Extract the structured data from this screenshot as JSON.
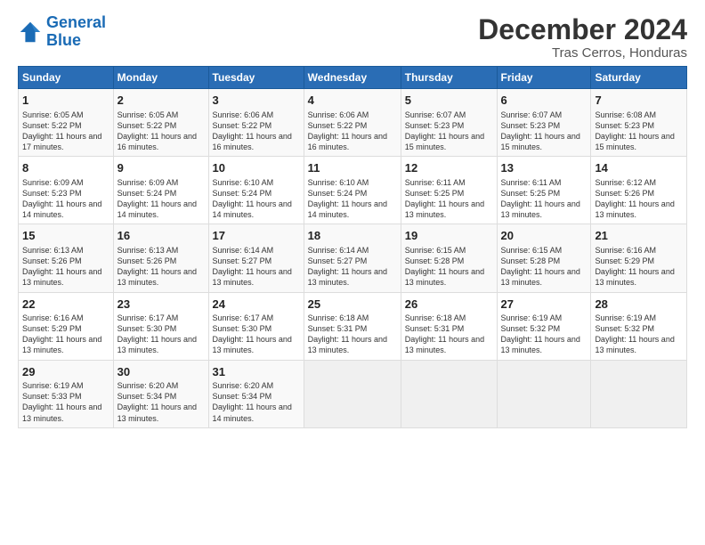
{
  "header": {
    "logo_line1": "General",
    "logo_line2": "Blue",
    "title": "December 2024",
    "subtitle": "Tras Cerros, Honduras"
  },
  "calendar": {
    "days_of_week": [
      "Sunday",
      "Monday",
      "Tuesday",
      "Wednesday",
      "Thursday",
      "Friday",
      "Saturday"
    ],
    "weeks": [
      [
        {
          "day": "1",
          "info": "Sunrise: 6:05 AM\nSunset: 5:22 PM\nDaylight: 11 hours and 17 minutes."
        },
        {
          "day": "2",
          "info": "Sunrise: 6:05 AM\nSunset: 5:22 PM\nDaylight: 11 hours and 16 minutes."
        },
        {
          "day": "3",
          "info": "Sunrise: 6:06 AM\nSunset: 5:22 PM\nDaylight: 11 hours and 16 minutes."
        },
        {
          "day": "4",
          "info": "Sunrise: 6:06 AM\nSunset: 5:22 PM\nDaylight: 11 hours and 16 minutes."
        },
        {
          "day": "5",
          "info": "Sunrise: 6:07 AM\nSunset: 5:23 PM\nDaylight: 11 hours and 15 minutes."
        },
        {
          "day": "6",
          "info": "Sunrise: 6:07 AM\nSunset: 5:23 PM\nDaylight: 11 hours and 15 minutes."
        },
        {
          "day": "7",
          "info": "Sunrise: 6:08 AM\nSunset: 5:23 PM\nDaylight: 11 hours and 15 minutes."
        }
      ],
      [
        {
          "day": "8",
          "info": "Sunrise: 6:09 AM\nSunset: 5:23 PM\nDaylight: 11 hours and 14 minutes."
        },
        {
          "day": "9",
          "info": "Sunrise: 6:09 AM\nSunset: 5:24 PM\nDaylight: 11 hours and 14 minutes."
        },
        {
          "day": "10",
          "info": "Sunrise: 6:10 AM\nSunset: 5:24 PM\nDaylight: 11 hours and 14 minutes."
        },
        {
          "day": "11",
          "info": "Sunrise: 6:10 AM\nSunset: 5:24 PM\nDaylight: 11 hours and 14 minutes."
        },
        {
          "day": "12",
          "info": "Sunrise: 6:11 AM\nSunset: 5:25 PM\nDaylight: 11 hours and 13 minutes."
        },
        {
          "day": "13",
          "info": "Sunrise: 6:11 AM\nSunset: 5:25 PM\nDaylight: 11 hours and 13 minutes."
        },
        {
          "day": "14",
          "info": "Sunrise: 6:12 AM\nSunset: 5:26 PM\nDaylight: 11 hours and 13 minutes."
        }
      ],
      [
        {
          "day": "15",
          "info": "Sunrise: 6:13 AM\nSunset: 5:26 PM\nDaylight: 11 hours and 13 minutes."
        },
        {
          "day": "16",
          "info": "Sunrise: 6:13 AM\nSunset: 5:26 PM\nDaylight: 11 hours and 13 minutes."
        },
        {
          "day": "17",
          "info": "Sunrise: 6:14 AM\nSunset: 5:27 PM\nDaylight: 11 hours and 13 minutes."
        },
        {
          "day": "18",
          "info": "Sunrise: 6:14 AM\nSunset: 5:27 PM\nDaylight: 11 hours and 13 minutes."
        },
        {
          "day": "19",
          "info": "Sunrise: 6:15 AM\nSunset: 5:28 PM\nDaylight: 11 hours and 13 minutes."
        },
        {
          "day": "20",
          "info": "Sunrise: 6:15 AM\nSunset: 5:28 PM\nDaylight: 11 hours and 13 minutes."
        },
        {
          "day": "21",
          "info": "Sunrise: 6:16 AM\nSunset: 5:29 PM\nDaylight: 11 hours and 13 minutes."
        }
      ],
      [
        {
          "day": "22",
          "info": "Sunrise: 6:16 AM\nSunset: 5:29 PM\nDaylight: 11 hours and 13 minutes."
        },
        {
          "day": "23",
          "info": "Sunrise: 6:17 AM\nSunset: 5:30 PM\nDaylight: 11 hours and 13 minutes."
        },
        {
          "day": "24",
          "info": "Sunrise: 6:17 AM\nSunset: 5:30 PM\nDaylight: 11 hours and 13 minutes."
        },
        {
          "day": "25",
          "info": "Sunrise: 6:18 AM\nSunset: 5:31 PM\nDaylight: 11 hours and 13 minutes."
        },
        {
          "day": "26",
          "info": "Sunrise: 6:18 AM\nSunset: 5:31 PM\nDaylight: 11 hours and 13 minutes."
        },
        {
          "day": "27",
          "info": "Sunrise: 6:19 AM\nSunset: 5:32 PM\nDaylight: 11 hours and 13 minutes."
        },
        {
          "day": "28",
          "info": "Sunrise: 6:19 AM\nSunset: 5:32 PM\nDaylight: 11 hours and 13 minutes."
        }
      ],
      [
        {
          "day": "29",
          "info": "Sunrise: 6:19 AM\nSunset: 5:33 PM\nDaylight: 11 hours and 13 minutes."
        },
        {
          "day": "30",
          "info": "Sunrise: 6:20 AM\nSunset: 5:34 PM\nDaylight: 11 hours and 13 minutes."
        },
        {
          "day": "31",
          "info": "Sunrise: 6:20 AM\nSunset: 5:34 PM\nDaylight: 11 hours and 14 minutes."
        },
        {
          "day": "",
          "info": ""
        },
        {
          "day": "",
          "info": ""
        },
        {
          "day": "",
          "info": ""
        },
        {
          "day": "",
          "info": ""
        }
      ]
    ]
  }
}
